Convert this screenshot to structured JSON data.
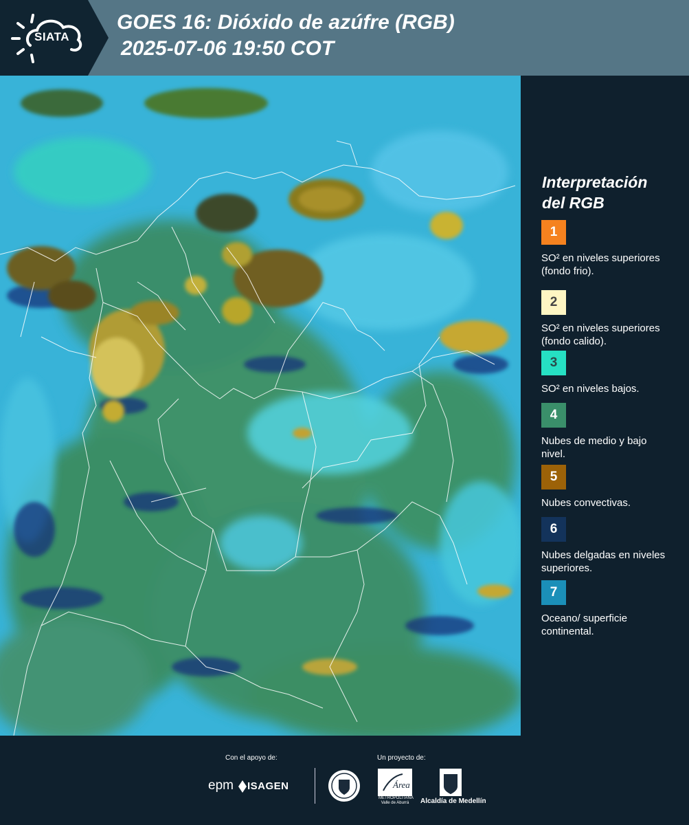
{
  "header": {
    "logo_text": "SIATA",
    "title_line1": "GOES 16: Dióxido de azúfre (RGB)",
    "title_line2": "2025-07-06 19:50 COT"
  },
  "legend": {
    "title_line1": "Interpretación",
    "title_line2": "del RGB",
    "items": [
      {
        "number": "1",
        "color": "#f5821f",
        "text_color": "#ffffff",
        "label": "SO² en niveles superiores (fondo frio)."
      },
      {
        "number": "2",
        "color": "#fef6c3",
        "text_color": "#444444",
        "label": "SO² en niveles superiores (fondo calido)."
      },
      {
        "number": "3",
        "color": "#26e0c3",
        "text_color": "#2a4a4a",
        "label": "SO² en niveles bajos."
      },
      {
        "number": "4",
        "color": "#3a8f6a",
        "text_color": "#ffffff",
        "label": "Nubes de medio y bajo nivel."
      },
      {
        "number": "5",
        "color": "#9c6208",
        "text_color": "#ffffff",
        "label": "Nubes convectivas."
      },
      {
        "number": "6",
        "color": "#13335b",
        "text_color": "#ffffff",
        "label": "Nubes delgadas en niveles superiores."
      },
      {
        "number": "7",
        "color": "#1b8fb8",
        "text_color": "#ffffff",
        "label": "Oceano/ superficie continental."
      }
    ]
  },
  "footer": {
    "support_label": "Con el apoyo de:",
    "project_label": "Un proyecto de:",
    "epm_logo": "epm",
    "isagen_logo": "ISAGEN",
    "medellin_seal": "medellin-seal-icon",
    "amva_logo_title": "Área",
    "amva_logo_text": "METROPOLITANA Valle de Aburrá",
    "alcaldia_logo": "Alcaldía de Medellín"
  }
}
